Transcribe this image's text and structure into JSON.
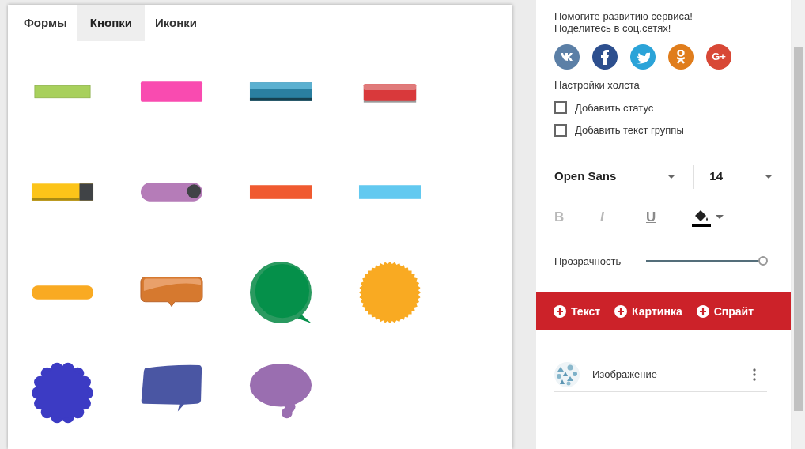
{
  "tabs": [
    {
      "label": "Формы",
      "selected": false
    },
    {
      "label": "Кнопки",
      "selected": true
    },
    {
      "label": "Иконки",
      "selected": false
    }
  ],
  "shapes": [
    {
      "kind": "bar",
      "color": "#a8d05c"
    },
    {
      "kind": "glow-bar",
      "color": "#f94bb0"
    },
    {
      "kind": "gradient-bar",
      "color": "#2a7fa0"
    },
    {
      "kind": "gloss-bar",
      "color": "#d9393b"
    },
    {
      "kind": "tab-bar",
      "color": "#fcc419"
    },
    {
      "kind": "toggle",
      "color": "#b57cb8"
    },
    {
      "kind": "flat-bar",
      "color": "#f05a30"
    },
    {
      "kind": "flat-bar",
      "color": "#62c9f0"
    },
    {
      "kind": "pill",
      "color": "#f9aa22"
    },
    {
      "kind": "callout",
      "color": "#d6792f"
    },
    {
      "kind": "round-bubble",
      "color": "#05904a"
    },
    {
      "kind": "starburst",
      "color": "#f9aa22"
    },
    {
      "kind": "scalloped",
      "color": "#3c3bc4"
    },
    {
      "kind": "speech-box",
      "color": "#4a56a3"
    },
    {
      "kind": "thought",
      "color": "#9a6eb0"
    }
  ],
  "share": {
    "lines": [
      "Помогите развитию сервиса!",
      "Поделитесь в соц.сетях!"
    ],
    "networks": [
      {
        "kind": "vk",
        "color": "#5b7fa6"
      },
      {
        "kind": "facebook",
        "color": "#2d4f8e"
      },
      {
        "kind": "twitter",
        "color": "#2ba3d8"
      },
      {
        "kind": "odnoklassniki",
        "color": "#e07d1c"
      },
      {
        "kind": "gplus",
        "color": "#d84836",
        "label": "G+"
      }
    ]
  },
  "canvas_settings": {
    "title": "Настройки холста",
    "options": [
      {
        "label": "Добавить статус",
        "checked": false
      },
      {
        "label": "Добавить текст группы",
        "checked": false
      }
    ]
  },
  "font": {
    "family": "Open Sans",
    "size": "14"
  },
  "format_buttons": [
    {
      "kind": "bold",
      "label": "B",
      "disabled": true
    },
    {
      "kind": "italic",
      "label": "I",
      "disabled": true
    },
    {
      "kind": "underline",
      "label": "U",
      "disabled": false
    }
  ],
  "opacity": {
    "label": "Прозрачность",
    "level": 1
  },
  "add_buttons": [
    {
      "label": "Текст"
    },
    {
      "label": "Картинка"
    },
    {
      "label": "Спрайт"
    }
  ],
  "layers": [
    {
      "name": "Изображение"
    }
  ]
}
